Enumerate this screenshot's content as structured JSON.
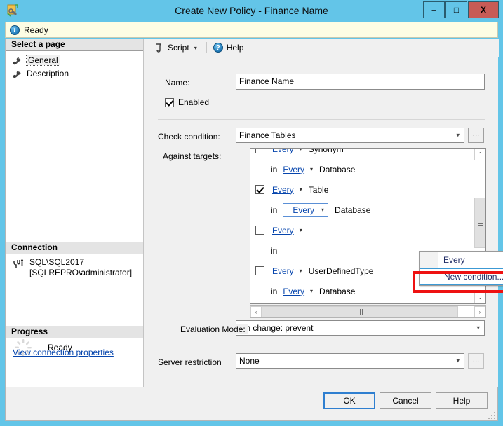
{
  "window": {
    "title": "Create New Policy - Finance Name",
    "icon": "policy-wrench-icon",
    "minimize_label": "–",
    "maximize_label": "□",
    "close_label": "X"
  },
  "status_banner": {
    "icon": "info-icon",
    "text": "Ready"
  },
  "sidebar": {
    "select_page_header": "Select a page",
    "pages": [
      {
        "label": "General",
        "icon": "wrench-icon",
        "selected": true
      },
      {
        "label": "Description",
        "icon": "wrench-icon",
        "selected": false
      }
    ],
    "connection_header": "Connection",
    "connection_icon": "server-connection-icon",
    "connection_server": "SQL\\SQL2017",
    "connection_user": "[SQLREPRO\\administrator]",
    "connection_link": "View connection properties",
    "progress_header": "Progress",
    "progress_icon": "spinner-icon",
    "progress_text": "Ready"
  },
  "toolbar": {
    "script_label": "Script",
    "script_icon": "script-icon",
    "script_caret": "▾",
    "help_label": "Help",
    "help_icon": "help-question-icon"
  },
  "form": {
    "name_label": "Name:",
    "name_value": "Finance Name",
    "enabled_label": "Enabled",
    "enabled_checked": true,
    "check_condition_label": "Check condition:",
    "check_condition_value": "Finance Tables",
    "check_condition_browse": "...",
    "against_targets_label": "Against targets:",
    "evaluation_mode_label": "Evaluation Mode:",
    "evaluation_mode_value": "On change: prevent",
    "server_restriction_label": "Server restriction",
    "server_restriction_value": "None",
    "server_restriction_browse": "..."
  },
  "targets_tree": {
    "rows": [
      {
        "type": "target",
        "checked": false,
        "every": "Every",
        "caret": "▾",
        "noun": "Synonym"
      },
      {
        "type": "scope",
        "in_word": "in",
        "every": "Every",
        "caret": "▾",
        "noun": "Database"
      },
      {
        "type": "target",
        "checked": true,
        "every": "Every",
        "caret": "▾",
        "noun": "Table"
      },
      {
        "type": "scope_active",
        "in_word": "in",
        "every": "Every",
        "caret": "▾",
        "noun": "Database"
      },
      {
        "type": "target",
        "checked": false,
        "every": "Every",
        "caret": "▾",
        "noun": ""
      },
      {
        "type": "scope",
        "in_word": "in",
        "every": "",
        "caret": "",
        "noun": ""
      },
      {
        "type": "target",
        "checked": false,
        "every": "Every",
        "caret": "▾",
        "noun": "UserDefinedType"
      },
      {
        "type": "scope",
        "in_word": "in",
        "every": "Every",
        "caret": "▾",
        "noun": "Database"
      }
    ],
    "scroll_up": "⌃",
    "scroll_down": "⌄",
    "scroll_left": "‹",
    "scroll_right": "›"
  },
  "dropdown": {
    "items": [
      {
        "label": "Every",
        "highlighted": false
      },
      {
        "label": "New condition...",
        "highlighted": true
      }
    ]
  },
  "annotation": {
    "color": "#ee1111",
    "target": "New condition..."
  },
  "footer": {
    "ok_label": "OK",
    "cancel_label": "Cancel",
    "help_label": "Help"
  }
}
